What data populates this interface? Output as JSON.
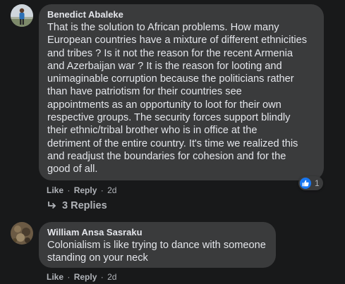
{
  "comments": [
    {
      "author": "Benedict Abaleke",
      "text_lines": [
        "That is the solution to African problems. How many",
        "European countries have a mixture of different ethnicities",
        "and tribes ? Is it not the reason for the recent Armenia",
        "and Azerbaijan war ? It is the reason for looting and",
        "unimaginable corruption because the politicians rather",
        "than have patriotism for their countries see",
        "appointments as an opportunity to loot for their own",
        "respective groups. The security forces support blindly",
        "their ethnic/tribal brother who is in office at the",
        "detriment of the entire country. It's time we realized this",
        "and readjust the boundaries for cohesion and for the",
        "good of all."
      ],
      "like_label": "Like",
      "reply_label": "Reply",
      "separator": "·",
      "time": "2d",
      "reaction_count": "1",
      "replies_label": "3 Replies"
    },
    {
      "author": "William Ansa Sasraku",
      "text_lines": [
        "Colonialism is like trying to dance with someone",
        "standing on your neck"
      ],
      "like_label": "Like",
      "reply_label": "Reply",
      "separator": "·",
      "time": "2d"
    }
  ],
  "colors": {
    "background": "#18191a",
    "bubble": "#3a3b3c",
    "text": "#e4e6eb",
    "secondary": "#b0b3b8",
    "like_blue": "#1877f2"
  },
  "icons": {
    "reaction": "thumbs-up-icon",
    "replies": "reply-arrow-icon"
  }
}
